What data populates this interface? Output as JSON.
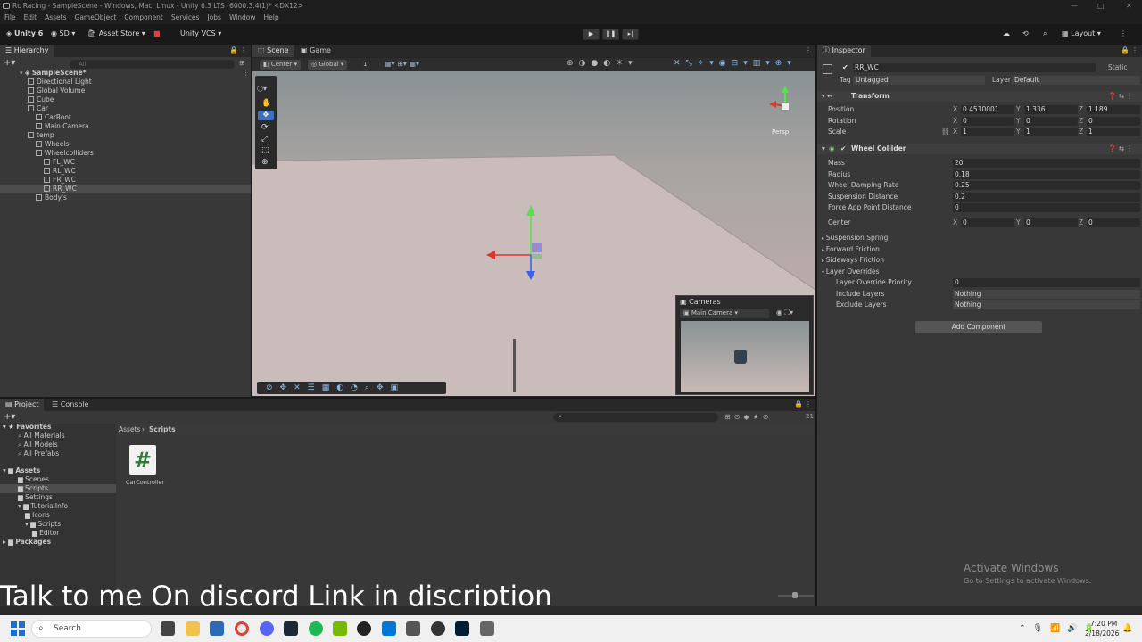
{
  "window": {
    "title": "Rc Racing - SampleScene - Windows, Mac, Linux - Unity 6.3 LTS (6000.3.4f1)* <DX12>",
    "min": "—",
    "max": "□",
    "close": "✕"
  },
  "menu": [
    "File",
    "Edit",
    "Assets",
    "GameObject",
    "Component",
    "Services",
    "Jobs",
    "Window",
    "Help"
  ],
  "toolbar": {
    "unity": "Unity 6",
    "account": "SD",
    "store": "Asset Store",
    "vcs": "Unity VCS",
    "layout": "Layout"
  },
  "hierarchy": {
    "title": "Hierarchy",
    "search_placeholder": "All",
    "items": [
      {
        "label": "SampleScene*",
        "depth": 0
      },
      {
        "label": "Directional Light",
        "depth": 1
      },
      {
        "label": "Global Volume",
        "depth": 1
      },
      {
        "label": "Cube",
        "depth": 1
      },
      {
        "label": "Car",
        "depth": 1
      },
      {
        "label": "CarRoot",
        "depth": 2
      },
      {
        "label": "Main Camera",
        "depth": 2
      },
      {
        "label": "temp",
        "depth": 1
      },
      {
        "label": "Wheels",
        "depth": 2
      },
      {
        "label": "Wheelcolliders",
        "depth": 2
      },
      {
        "label": "FL_WC",
        "depth": 3
      },
      {
        "label": "RL_WC",
        "depth": 3
      },
      {
        "label": "FR_WC",
        "depth": 3
      },
      {
        "label": "RR_WC",
        "depth": 3
      },
      {
        "label": "Body's",
        "depth": 2
      }
    ]
  },
  "scene": {
    "tabs": [
      "Scene",
      "Game"
    ],
    "pivot": "Center",
    "space": "Global",
    "grid_count": "1",
    "persp": "Persp",
    "cameras_overlay": {
      "title": "Cameras",
      "selected": "Main Camera"
    }
  },
  "inspector": {
    "title": "Inspector",
    "object_name": "RR_WC",
    "static": "Static",
    "tag_label": "Tag",
    "tag": "Untagged",
    "layer_label": "Layer",
    "layer": "Default",
    "transform": {
      "title": "Transform",
      "position": {
        "label": "Position",
        "x": "0.4510001",
        "y": "1.336",
        "z": "1.189"
      },
      "rotation": {
        "label": "Rotation",
        "x": "0",
        "y": "0",
        "z": "0"
      },
      "scale": {
        "label": "Scale",
        "x": "1",
        "y": "1",
        "z": "1"
      }
    },
    "wheel": {
      "title": "Wheel Collider",
      "fields": [
        {
          "label": "Mass",
          "value": "20"
        },
        {
          "label": "Radius",
          "value": "0.18"
        },
        {
          "label": "Wheel Damping Rate",
          "value": "0.25"
        },
        {
          "label": "Suspension Distance",
          "value": "0.2"
        },
        {
          "label": "Force App Point Distance",
          "value": "0"
        }
      ],
      "center": {
        "label": "Center",
        "x": "0",
        "y": "0",
        "z": "0"
      },
      "foldouts": [
        "Suspension Spring",
        "Forward Friction",
        "Sideways Friction",
        "Layer Overrides"
      ],
      "layer_priority": {
        "label": "Layer Override Priority",
        "value": "0"
      },
      "include": {
        "label": "Include Layers",
        "value": "Nothing"
      },
      "exclude": {
        "label": "Exclude Layers",
        "value": "Nothing"
      }
    },
    "add_component": "Add Component"
  },
  "project": {
    "tabs": [
      "Project",
      "Console"
    ],
    "favorites": "Favorites",
    "fav_items": [
      "All Materials",
      "All Models",
      "All Prefabs"
    ],
    "assets": "Assets",
    "asset_items": [
      {
        "label": "Scenes",
        "depth": 1
      },
      {
        "label": "Scripts",
        "depth": 1
      },
      {
        "label": "Settings",
        "depth": 1
      },
      {
        "label": "TutorialInfo",
        "depth": 1
      },
      {
        "label": "Icons",
        "depth": 2
      },
      {
        "label": "Scripts",
        "depth": 2
      },
      {
        "label": "Editor",
        "depth": 3
      }
    ],
    "packages": "Packages",
    "breadcrumb": [
      "Assets",
      "Scripts"
    ],
    "file": "CarController",
    "count": "21"
  },
  "overlay_text": "Talk to me On discord Link in discription",
  "activate": {
    "title": "Activate Windows",
    "sub": "Go to Settings to activate Windows."
  },
  "taskbar": {
    "search": "Search",
    "time": "7:20 PM",
    "date": "2/18/2026"
  }
}
